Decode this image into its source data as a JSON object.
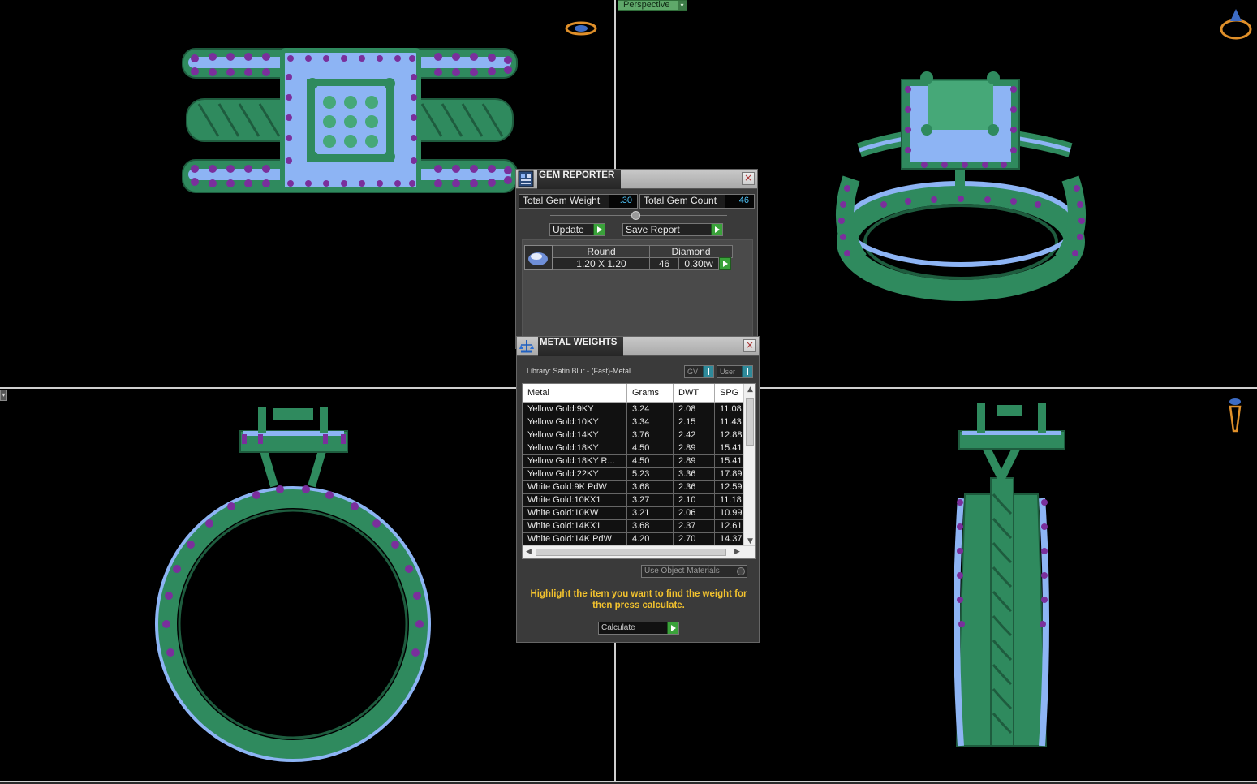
{
  "viewport": {
    "perspective_label": "Perspective"
  },
  "colors": {
    "ring_metal": "#2f8a5e",
    "ring_metal_light": "#46a878",
    "gem_blue": "#8db4f4",
    "prong_purple": "#7a2f9c",
    "accent_green": "#3aa23a",
    "hint_yellow": "#f2c22e",
    "value_cyan": "#4fc3f7"
  },
  "gem_reporter": {
    "title": "GEM REPORTER",
    "total_weight_label": "Total Gem Weight",
    "total_weight_value": ".30",
    "total_count_label": "Total Gem Count",
    "total_count_value": "46",
    "update_label": "Update",
    "save_report_label": "Save Report",
    "gem": {
      "shape": "Round",
      "material": "Diamond",
      "size": "1.20 X 1.20",
      "count": "46",
      "weight": "0.30tw"
    }
  },
  "metal_weights": {
    "title": "METAL WEIGHTS",
    "library": "Library: Satin Blur - (Fast)-Metal",
    "gv_label": "GV",
    "user_label": "User",
    "columns": [
      "Metal",
      "Grams",
      "DWT",
      "SPG"
    ],
    "rows": [
      [
        "Yellow Gold:9KY",
        "3.24",
        "2.08",
        "11.08"
      ],
      [
        "Yellow Gold:10KY",
        "3.34",
        "2.15",
        "11.43"
      ],
      [
        "Yellow Gold:14KY",
        "3.76",
        "2.42",
        "12.88"
      ],
      [
        "Yellow Gold:18KY",
        "4.50",
        "2.89",
        "15.41"
      ],
      [
        "Yellow Gold:18KY R...",
        "4.50",
        "2.89",
        "15.41"
      ],
      [
        "Yellow Gold:22KY",
        "5.23",
        "3.36",
        "17.89"
      ],
      [
        "White Gold:9K PdW",
        "3.68",
        "2.36",
        "12.59"
      ],
      [
        "White Gold:10KX1",
        "3.27",
        "2.10",
        "11.18"
      ],
      [
        "White Gold:10KW",
        "3.21",
        "2.06",
        "10.99"
      ],
      [
        "White Gold:14KX1",
        "3.68",
        "2.37",
        "12.61"
      ],
      [
        "White Gold:14K PdW",
        "4.20",
        "2.70",
        "14.37"
      ]
    ],
    "use_object_materials_label": "Use Object Materials",
    "hint": "Highlight the item you want to find the weight for then press calculate.",
    "calculate_label": "Calculate"
  },
  "icons": {
    "gem_reporter_icon": "gem-report-icon",
    "metal_weights_icon": "scale-icon",
    "nav_top": "ring-nav-icon",
    "nav_persp": "ring-nav-icon",
    "nav_right": "ring-nav-icon"
  }
}
